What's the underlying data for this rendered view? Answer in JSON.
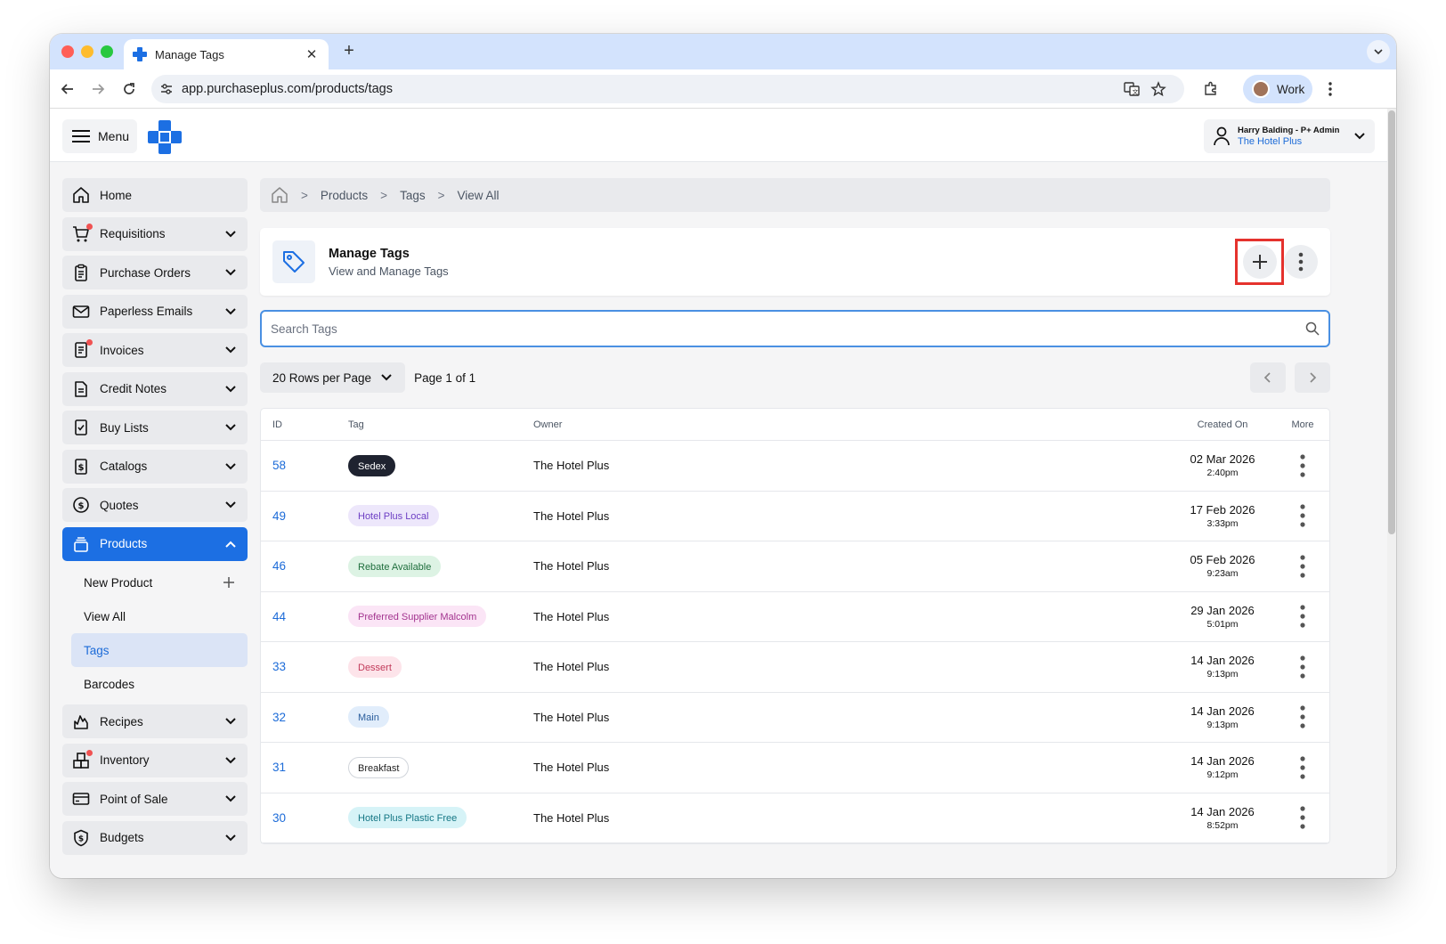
{
  "browser": {
    "tab_title": "Manage Tags",
    "new_tab": "+",
    "url": "app.purchaseplus.com/products/tags",
    "profile_label": "Work"
  },
  "header": {
    "menu_label": "Menu",
    "user_name": "Harry Balding - P+ Admin",
    "user_org": "The Hotel Plus"
  },
  "sidebar": {
    "items": [
      {
        "label": "Home",
        "icon": "home-icon",
        "dot": false,
        "chevron": false
      },
      {
        "label": "Requisitions",
        "icon": "cart-icon",
        "dot": true,
        "chevron": true
      },
      {
        "label": "Purchase Orders",
        "icon": "clipboard-icon",
        "dot": false,
        "chevron": true
      },
      {
        "label": "Paperless Emails",
        "icon": "envelope-icon",
        "dot": false,
        "chevron": true
      },
      {
        "label": "Invoices",
        "icon": "invoice-icon",
        "dot": true,
        "chevron": true
      },
      {
        "label": "Credit Notes",
        "icon": "document-icon",
        "dot": false,
        "chevron": true
      },
      {
        "label": "Buy Lists",
        "icon": "checklist-icon",
        "dot": false,
        "chevron": true
      },
      {
        "label": "Catalogs",
        "icon": "catalog-dollar-icon",
        "dot": false,
        "chevron": true
      },
      {
        "label": "Quotes",
        "icon": "dollar-circle-icon",
        "dot": false,
        "chevron": true
      },
      {
        "label": "Products",
        "icon": "products-stack-icon",
        "dot": false,
        "chevron": true,
        "active": true
      }
    ],
    "sub_items": [
      {
        "label": "New Product",
        "plus": true
      },
      {
        "label": "View All"
      },
      {
        "label": "Tags",
        "active": true
      },
      {
        "label": "Barcodes"
      }
    ],
    "items_after": [
      {
        "label": "Recipes",
        "icon": "flame-icon",
        "dot": false
      },
      {
        "label": "Inventory",
        "icon": "boxes-icon",
        "dot": true
      },
      {
        "label": "Point of Sale",
        "icon": "card-icon",
        "dot": false
      },
      {
        "label": "Budgets",
        "icon": "shield-dollar-icon",
        "dot": false
      }
    ]
  },
  "breadcrumb": [
    "Products",
    "Tags",
    "View All"
  ],
  "page": {
    "title": "Manage Tags",
    "subtitle": "View and Manage Tags"
  },
  "search": {
    "placeholder": "Search Tags",
    "value": ""
  },
  "pagination": {
    "rows_label": "20 Rows per Page",
    "page_info": "Page 1 of 1"
  },
  "table": {
    "headers": {
      "id": "ID",
      "tag": "Tag",
      "owner": "Owner",
      "created": "Created On",
      "more": "More"
    },
    "rows": [
      {
        "id": "58",
        "tag": "Sedex",
        "bg": "#1f2330",
        "fg": "#ffffff",
        "border": "#1f2330",
        "owner": "The Hotel Plus",
        "date": "02 Mar 2026",
        "time": "2:40pm"
      },
      {
        "id": "49",
        "tag": "Hotel Plus Local",
        "bg": "#ede7fb",
        "fg": "#6d3fc4",
        "border": "#ede7fb",
        "owner": "The Hotel Plus",
        "date": "17 Feb 2026",
        "time": "3:33pm"
      },
      {
        "id": "46",
        "tag": "Rebate Available",
        "bg": "#ddf3e4",
        "fg": "#1f6e3d",
        "border": "#ddf3e4",
        "owner": "The Hotel Plus",
        "date": "05 Feb 2026",
        "time": "9:23am"
      },
      {
        "id": "44",
        "tag": "Preferred Supplier Malcolm",
        "bg": "#fbe5f6",
        "fg": "#a3348f",
        "border": "#fbe5f6",
        "owner": "The Hotel Plus",
        "date": "29 Jan 2026",
        "time": "5:01pm"
      },
      {
        "id": "33",
        "tag": "Dessert",
        "bg": "#fde4ea",
        "fg": "#c23a5a",
        "border": "#fde4ea",
        "owner": "The Hotel Plus",
        "date": "14 Jan 2026",
        "time": "9:13pm"
      },
      {
        "id": "32",
        "tag": "Main",
        "bg": "#e1edfb",
        "fg": "#2a5d9c",
        "border": "#e1edfb",
        "owner": "The Hotel Plus",
        "date": "14 Jan 2026",
        "time": "9:13pm"
      },
      {
        "id": "31",
        "tag": "Breakfast",
        "bg": "#ffffff",
        "fg": "#222222",
        "border": "#d1d5db",
        "owner": "The Hotel Plus",
        "date": "14 Jan 2026",
        "time": "9:12pm"
      },
      {
        "id": "30",
        "tag": "Hotel Plus Plastic Free",
        "bg": "#d6f3f7",
        "fg": "#157785",
        "border": "#d6f3f7",
        "owner": "The Hotel Plus",
        "date": "14 Jan 2026",
        "time": "8:52pm"
      }
    ]
  },
  "colors": {
    "accent": "#1c6fe3",
    "highlight_frame": "#e5322d"
  }
}
